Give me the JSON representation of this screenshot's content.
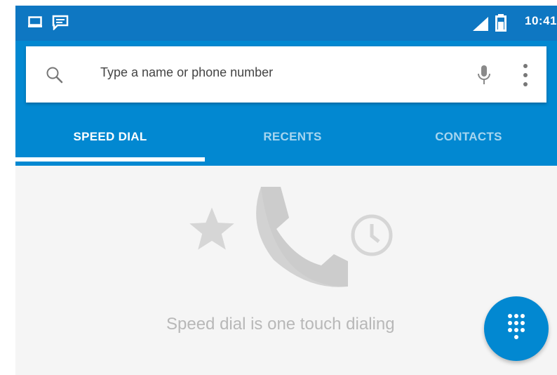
{
  "status_bar": {
    "time": "10:41",
    "left_icons": [
      "gallery-notification-icon",
      "message-notification-icon"
    ],
    "right_icons": [
      "signal-icon",
      "battery-icon"
    ]
  },
  "search": {
    "placeholder": "Type a name or phone number",
    "icons": [
      "search-icon",
      "mic-icon",
      "more-vert-icon"
    ]
  },
  "tabs": [
    {
      "label": "SPEED DIAL",
      "selected": true
    },
    {
      "label": "RECENTS",
      "selected": false
    },
    {
      "label": "CONTACTS",
      "selected": false
    }
  ],
  "empty_state": {
    "message": "Speed dial is one touch dialing",
    "icons": [
      "star-icon",
      "phone-icon",
      "clock-icon"
    ]
  },
  "fab": {
    "icon": "dialpad-icon"
  },
  "colors": {
    "status_bar": "#0e77c2",
    "app_bar": "#0288d1",
    "background": "#f5f5f5",
    "empty_text": "#b8b8b8",
    "placeholder_icon": "#d4d4d4"
  }
}
